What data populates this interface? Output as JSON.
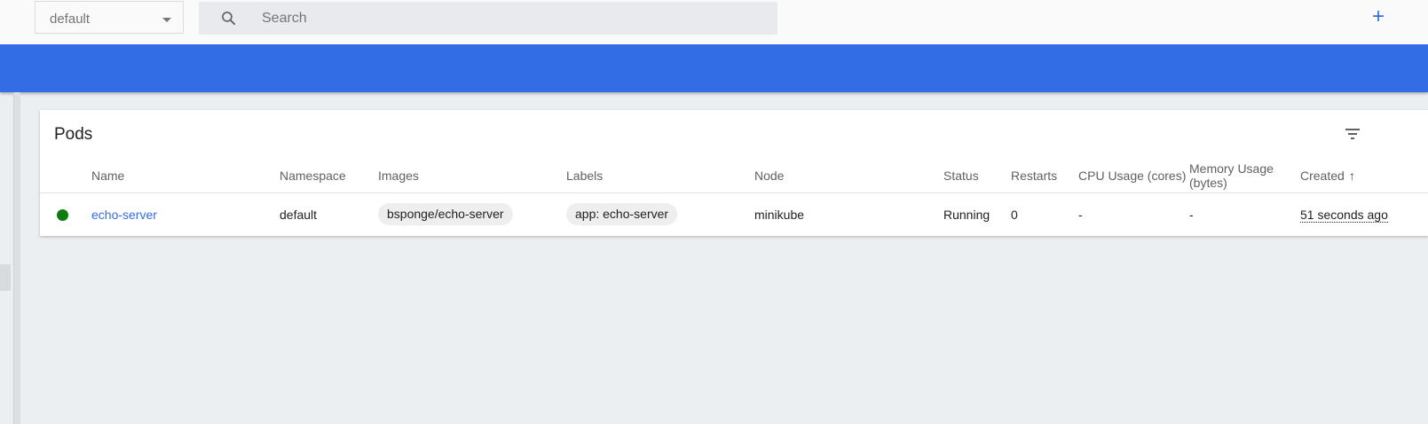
{
  "toolbar": {
    "namespace": "default",
    "search_placeholder": "Search",
    "create_label": "+"
  },
  "card": {
    "title": "Pods",
    "columns": [
      "Name",
      "Namespace",
      "Images",
      "Labels",
      "Node",
      "Status",
      "Restarts",
      "CPU Usage (cores)",
      "Memory Usage (bytes)",
      "Created"
    ],
    "rows": [
      {
        "name": "echo-server",
        "namespace": "default",
        "image": "bsponge/echo-server",
        "label": "app: echo-server",
        "node": "minikube",
        "status": "Running",
        "restarts": "0",
        "cpu": "-",
        "memory": "-",
        "created": "51 seconds ago"
      }
    ]
  },
  "icons": {
    "search": "search-icon",
    "filter": "filter-icon",
    "status": "status-dot-icon",
    "sort": "arrow-up-icon",
    "dropdown": "caret-down-icon"
  },
  "colors": {
    "accent": "#326de6",
    "status_running": "#0d7b0d",
    "background": "#eceff1"
  }
}
